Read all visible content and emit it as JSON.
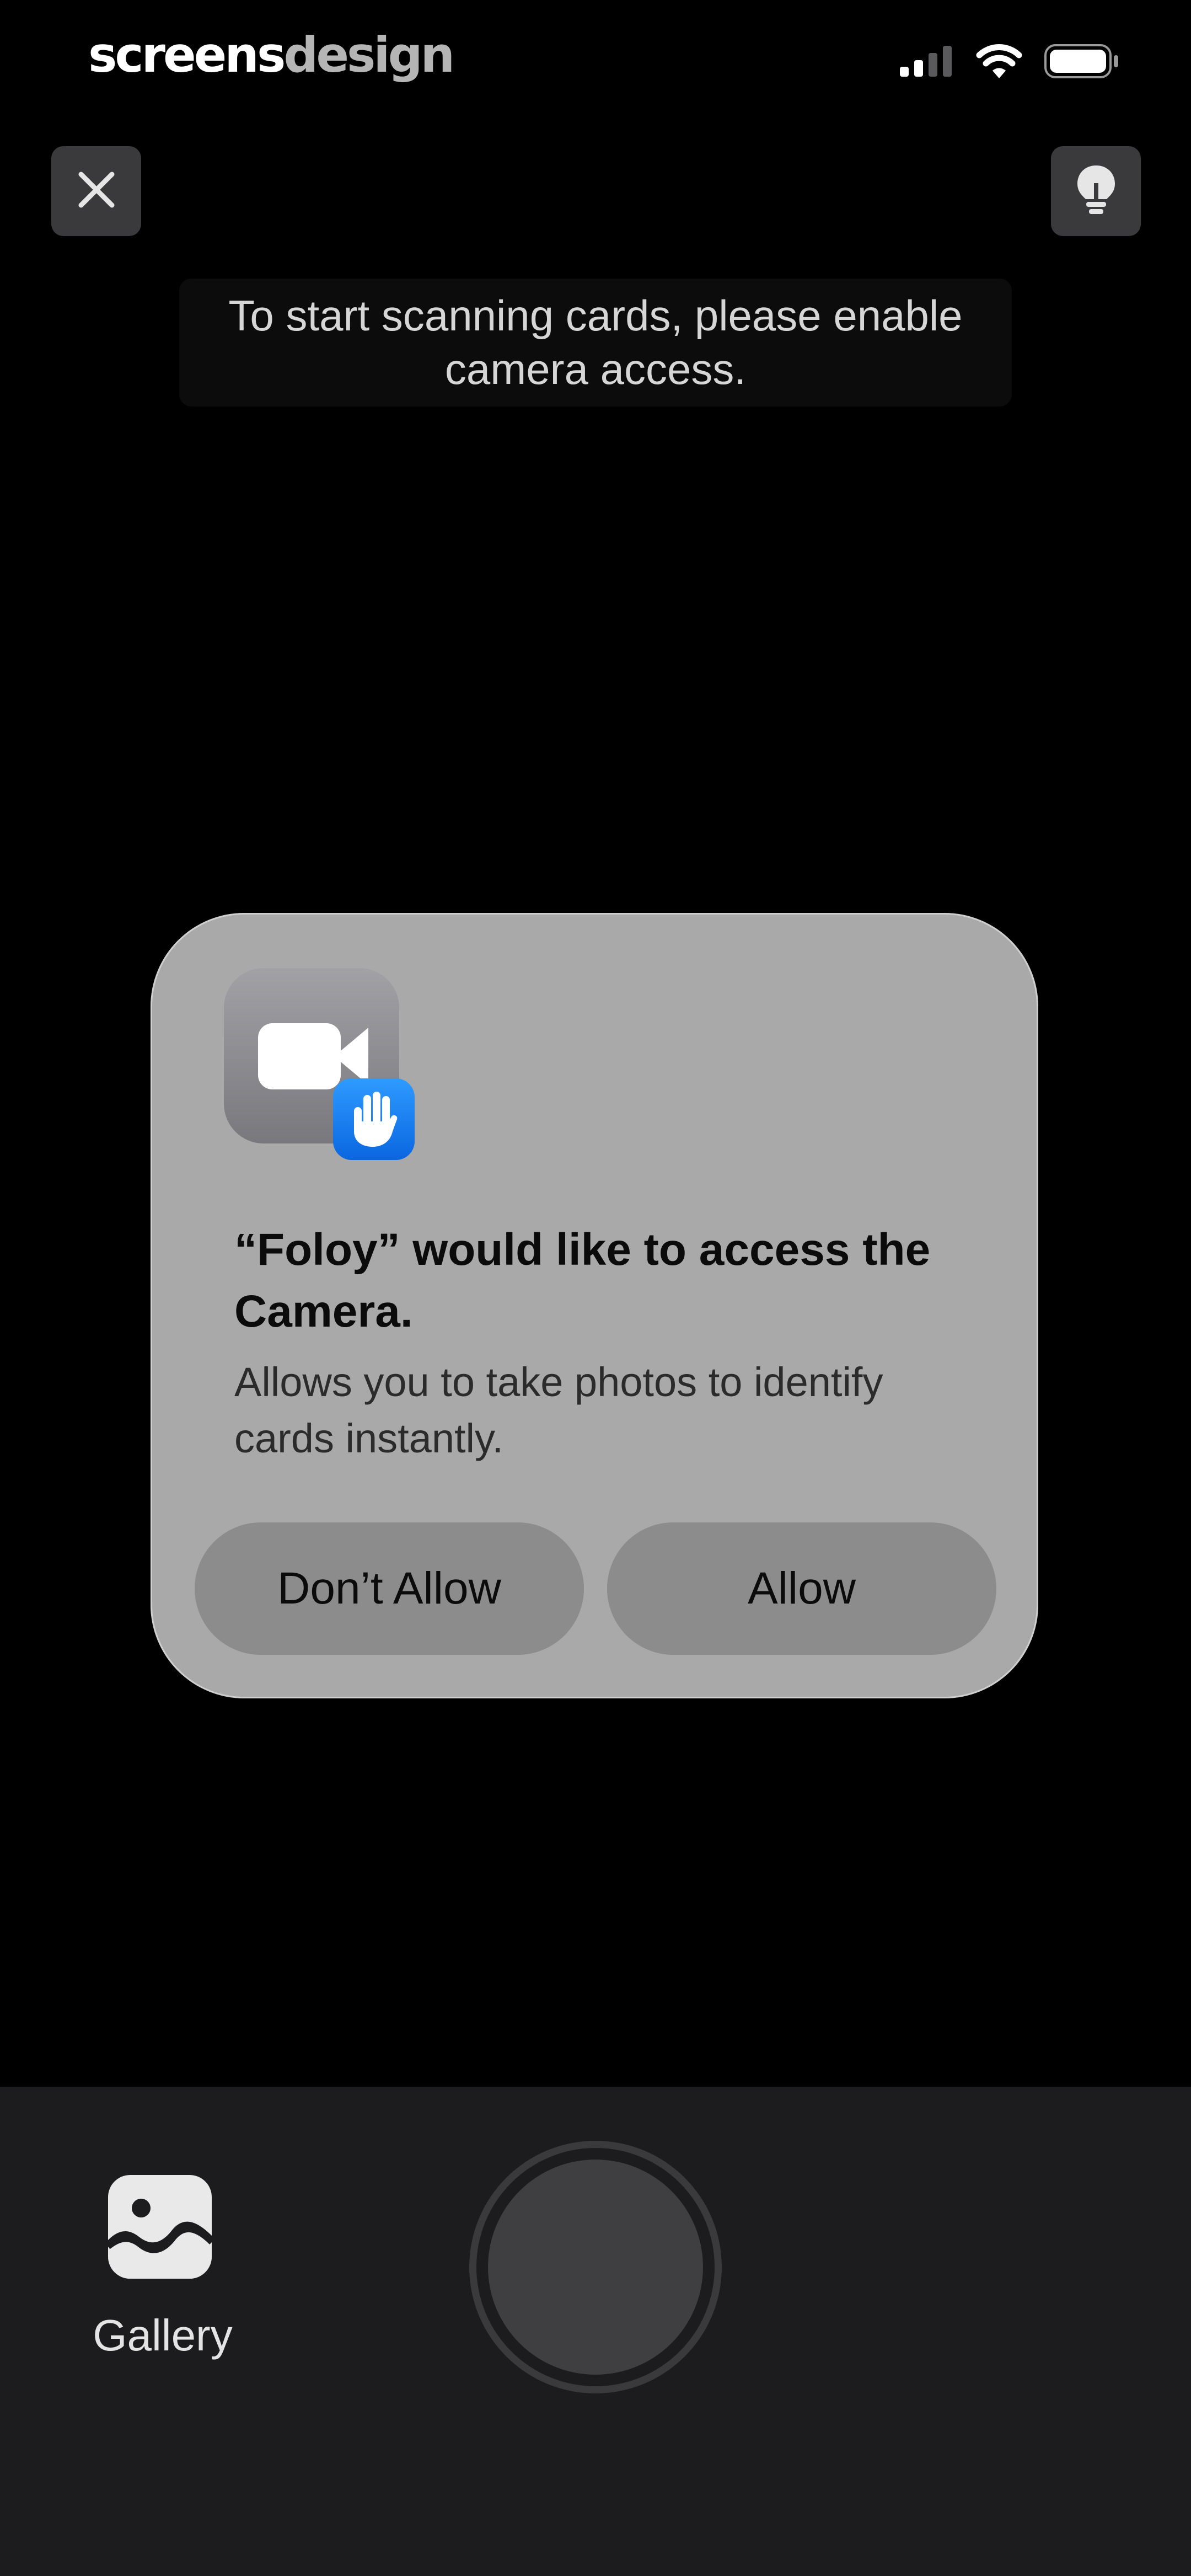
{
  "status_bar": {
    "brand_part1": "screens",
    "brand_part2": "design",
    "signal_icon": "cellular-signal-icon",
    "wifi_icon": "wifi-icon",
    "battery_icon": "battery-icon"
  },
  "toolbar": {
    "close_icon": "close-icon",
    "hint_icon": "lightbulb-icon"
  },
  "notice": {
    "text": "To start scanning cards, please enable camera access."
  },
  "alert": {
    "app_icon": "camera-video-icon",
    "badge_icon": "hand-icon",
    "title": "“Foloy” would like to access the Camera.",
    "message": "Allows you to take photos to identify cards instantly.",
    "deny_label": "Don’t Allow",
    "allow_label": "Allow"
  },
  "bottom_bar": {
    "gallery_icon": "gallery-image-icon",
    "gallery_label": "Gallery",
    "shutter_icon": "shutter-button"
  },
  "colors": {
    "background": "#000000",
    "alert_background": "#a9a9a9",
    "alert_button": "#8c8c8c",
    "badge_blue": "#1a84f5",
    "bottom_bar": "#1c1c1e",
    "top_button": "#3a3a3c"
  }
}
